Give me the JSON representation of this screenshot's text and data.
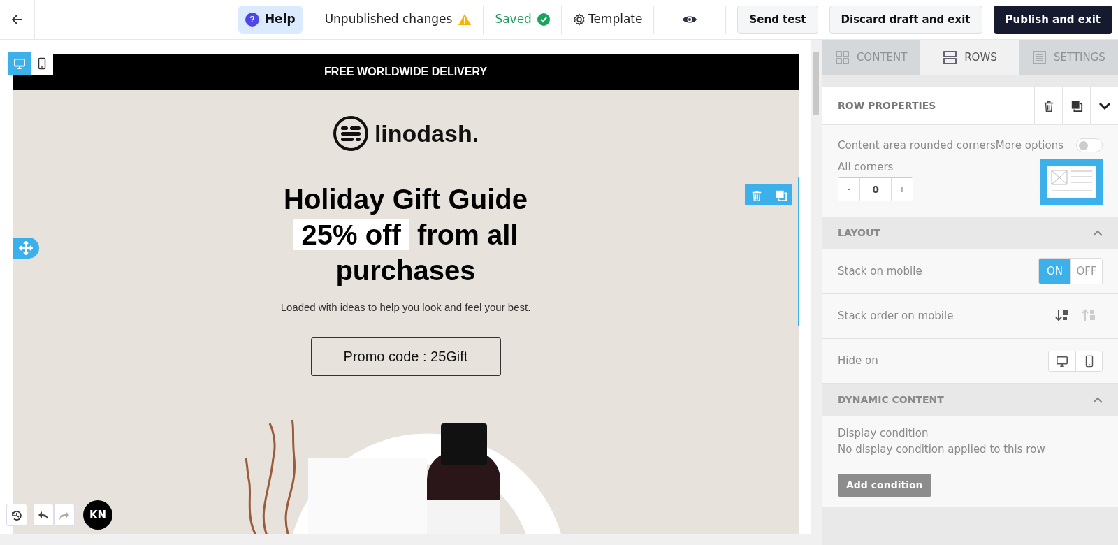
{
  "topbar": {
    "help_icon": "?",
    "help": "Help",
    "status": "Unpublished changes",
    "saved": "Saved",
    "template": "Template",
    "buttons": [
      {
        "label": "Send test",
        "kind": "light"
      },
      {
        "label": "Discard draft and exit",
        "kind": "light"
      },
      {
        "label": "Publish and exit",
        "kind": "dark"
      }
    ]
  },
  "device_toggle": [
    {
      "kind": "desktop",
      "selected": true
    },
    {
      "kind": "mobile",
      "selected": false
    }
  ],
  "email": {
    "banner": "FREE WORLDWIDE DELIVERY",
    "logo": "linodash.",
    "headline": "Holiday Gift Guide",
    "highlight": "25% off",
    "headline_rest": "from all purchases",
    "subtitle": "Loaded with ideas to help you look and feel your best.",
    "promo": "Promo code : 25Gift"
  },
  "avatar": "KN",
  "panel": {
    "tabs": [
      {
        "label": "CONTENT",
        "kind": "grid",
        "selected": false
      },
      {
        "label": "ROWS",
        "kind": "rows",
        "selected": true
      },
      {
        "label": "SETTINGS",
        "kind": "doc",
        "selected": false
      }
    ],
    "title": "ROW PROPERTIES",
    "rounded_corners": {
      "label": "Content area rounded corners",
      "more_options": "More options",
      "on": false
    },
    "all_corners": {
      "label": "All corners",
      "minus": "-",
      "value": "0",
      "plus": "+"
    },
    "layout": {
      "title": "LAYOUT",
      "expanded": true,
      "stack_on_mobile": {
        "label": "Stack on mobile",
        "options": [
          {
            "label": "ON",
            "selected": true
          },
          {
            "label": "OFF",
            "selected": false
          }
        ]
      },
      "stack_order": {
        "label": "Stack order on mobile",
        "options": [
          {
            "kind": "down",
            "selected": true
          },
          {
            "kind": "up",
            "selected": false
          }
        ]
      },
      "hide_on": {
        "label": "Hide on",
        "options": [
          {
            "kind": "desktop",
            "selected": false
          },
          {
            "kind": "mobile",
            "selected": false
          }
        ]
      }
    },
    "dynamic": {
      "title": "DYNAMIC CONTENT",
      "expanded": true,
      "label": "Display condition",
      "note": "No display condition applied to this row",
      "button": "Add condition"
    }
  }
}
